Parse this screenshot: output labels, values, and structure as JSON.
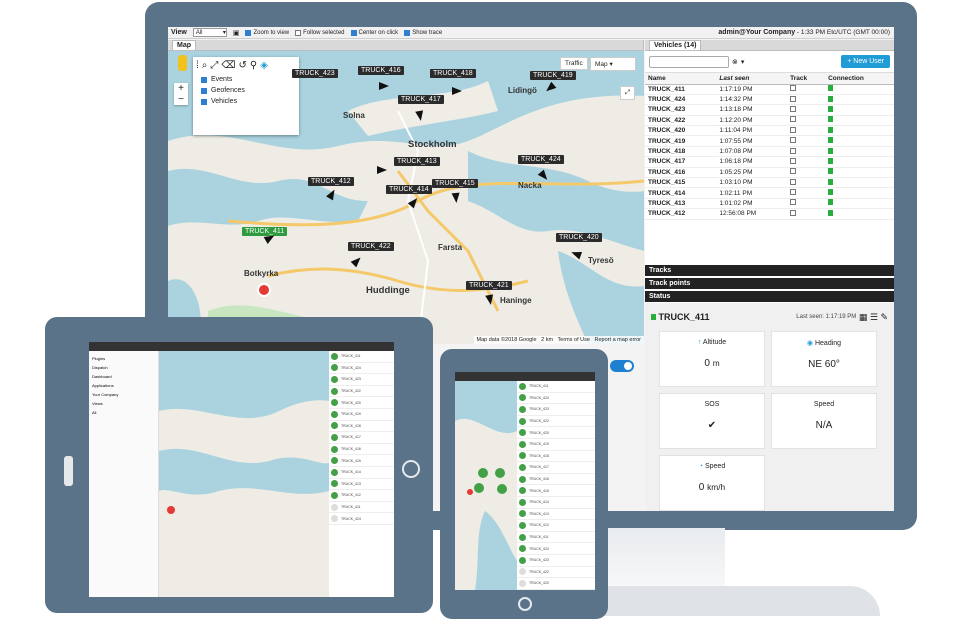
{
  "topbar": {
    "view_label": "View",
    "view_select": "All",
    "options": [
      "Zoom to view",
      "Follow selected",
      "Center on click",
      "Show trace"
    ],
    "options_checked": [
      true,
      false,
      true,
      true
    ],
    "user": "admin@Your Company",
    "time": "1:33 PM Etc/UTC (GMT 00:00)"
  },
  "map_panel": {
    "tab": "Map",
    "layers": [
      "Events",
      "Geofences",
      "Vehicles"
    ],
    "traffic_button": "Traffic",
    "map_select": "Map",
    "places": [
      "Stockholm",
      "Lidingö",
      "Solna",
      "Huddinge",
      "Botkyrka",
      "Nacka",
      "Farsta",
      "Tyresö",
      "Haninge"
    ],
    "attribution": [
      "Map data ©2018 Google",
      "2 km",
      "Terms of Use",
      "Report a map error"
    ],
    "trucks": [
      "TRUCK_416",
      "TRUCK_418",
      "TRUCK_419",
      "TRUCK_417",
      "TRUCK_423",
      "TRUCK_413",
      "TRUCK_424",
      "TRUCK_412",
      "TRUCK_414",
      "TRUCK_415",
      "TRUCK_411",
      "TRUCK_422",
      "TRUCK_420",
      "TRUCK_421"
    ]
  },
  "vehicles": {
    "title": "Vehicles (14)",
    "new_user": "+ New User",
    "columns": [
      "Name",
      "Last seen",
      "Track",
      "Connection"
    ],
    "rows": [
      [
        "TRUCK_411",
        "1:17:19 PM"
      ],
      [
        "TRUCK_424",
        "1:14:32 PM"
      ],
      [
        "TRUCK_423",
        "1:13:18 PM"
      ],
      [
        "TRUCK_422",
        "1:12:20 PM"
      ],
      [
        "TRUCK_420",
        "1:11:04 PM"
      ],
      [
        "TRUCK_419",
        "1:07:55 PM"
      ],
      [
        "TRUCK_418",
        "1:07:08 PM"
      ],
      [
        "TRUCK_417",
        "1:06:18 PM"
      ],
      [
        "TRUCK_416",
        "1:05:25 PM"
      ],
      [
        "TRUCK_415",
        "1:03:10 PM"
      ],
      [
        "TRUCK_414",
        "1:02:11 PM"
      ],
      [
        "TRUCK_413",
        "1:01:02 PM"
      ],
      [
        "TRUCK_412",
        "12:56:08 PM"
      ]
    ]
  },
  "sections": [
    "Tracks",
    "Track points",
    "Status"
  ],
  "status": {
    "vehicle": "TRUCK_411",
    "last_seen": "Last seen: 1:17:19 PM",
    "cards": [
      {
        "label": "Altitude",
        "value": "0",
        "unit": "m"
      },
      {
        "label": "Heading",
        "value": "NE 60°",
        "unit": ""
      },
      {
        "label": "SOS",
        "value": "✔",
        "unit": ""
      },
      {
        "label": "Speed",
        "value": "N/A",
        "unit": ""
      },
      {
        "label": "Speed",
        "value": "0",
        "unit": "km/h"
      }
    ]
  },
  "tablet": {
    "sidebar": [
      "Plugins",
      "Dispatch",
      "Dashboard",
      "Applications",
      "Your Company",
      "Views",
      "All"
    ]
  },
  "colors": {
    "frame": "#5a7389",
    "accent": "#1f9bd6",
    "green": "#27ae3e"
  }
}
